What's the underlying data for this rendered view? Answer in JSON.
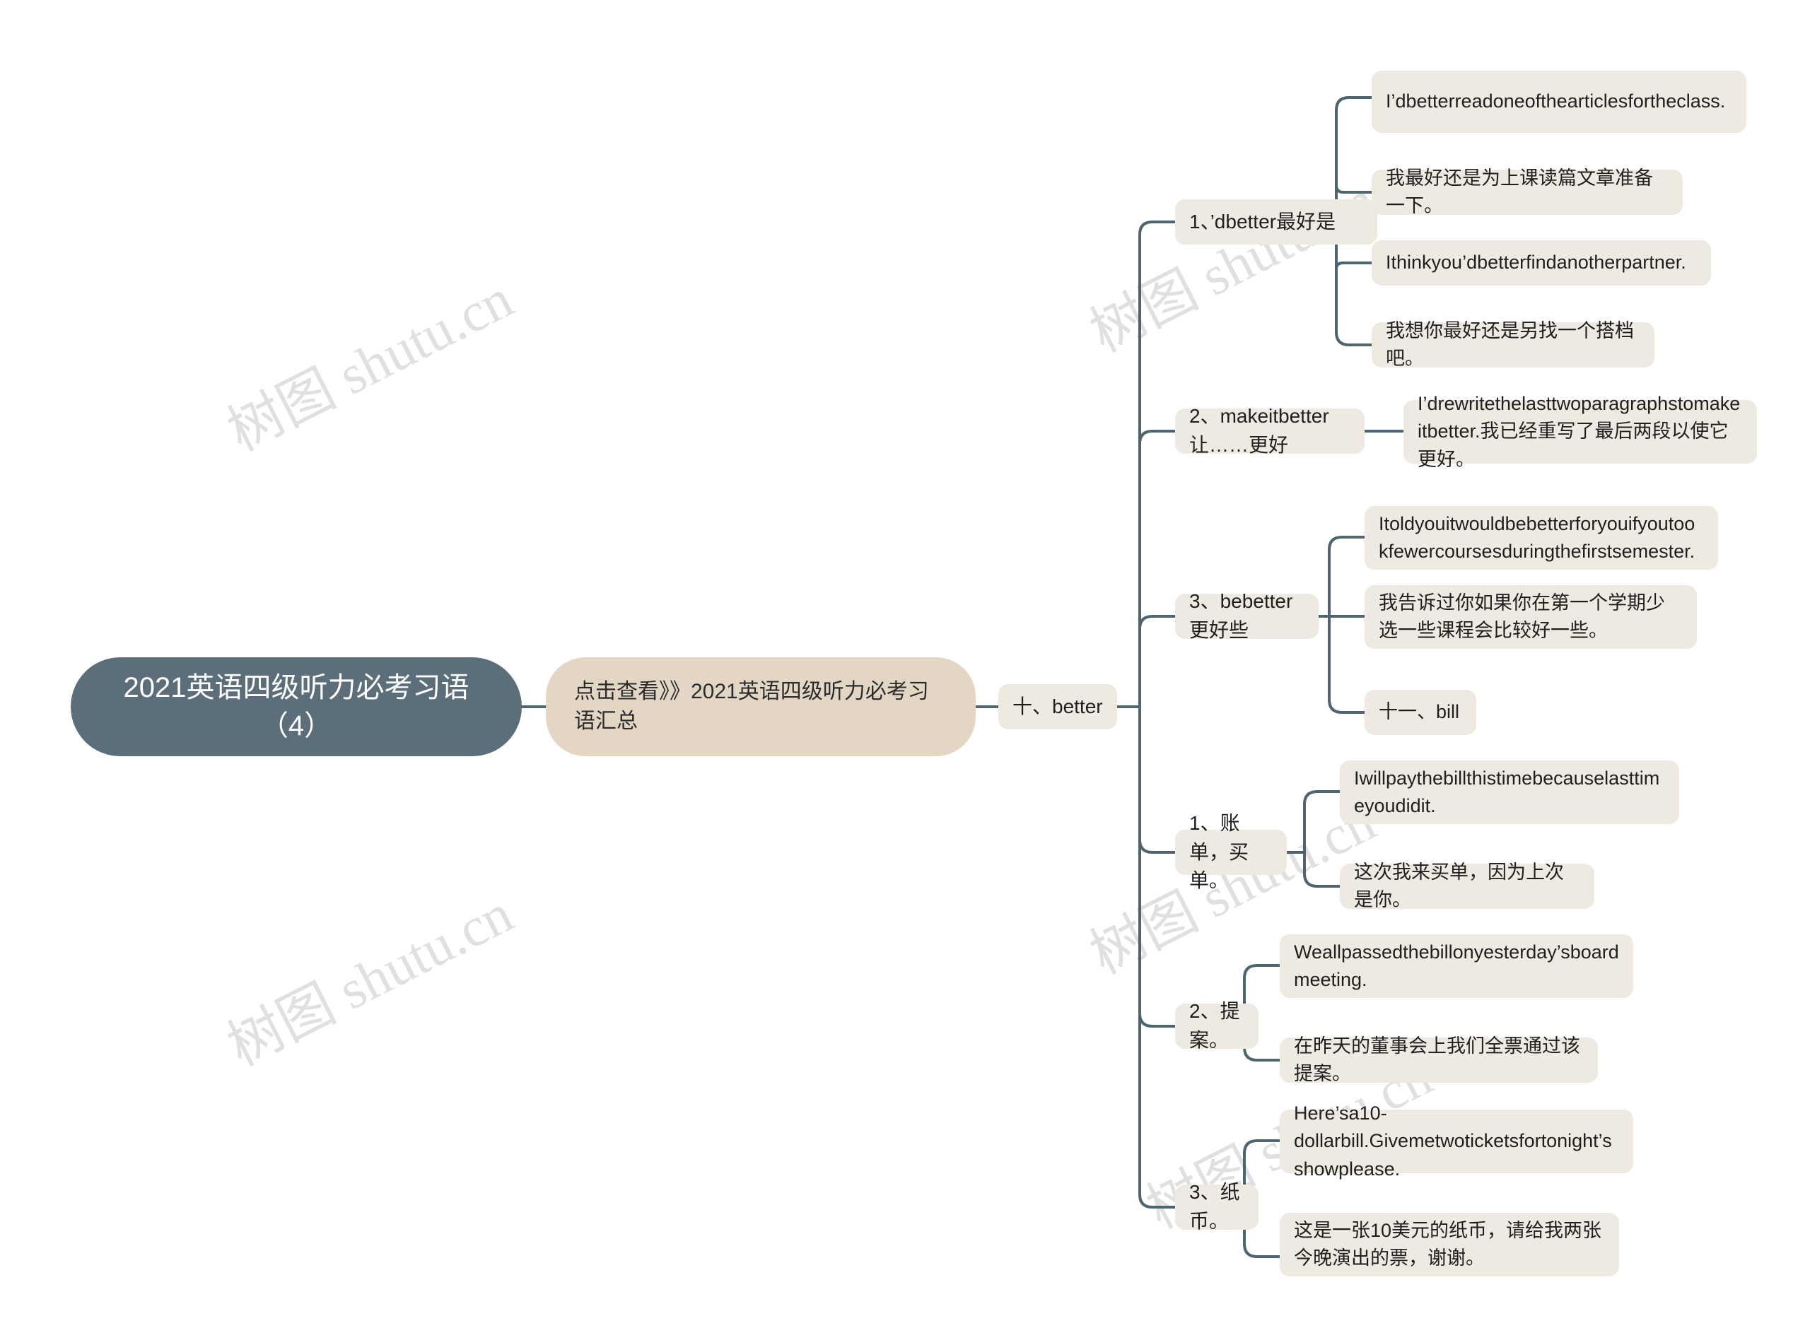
{
  "meta": {
    "background": "#ffffff",
    "root_color": "#5c6e79",
    "branch_color": "#e3d6c4",
    "node_color": "#eeeae1",
    "link_color": "#4e646e",
    "text_color": "#1f1f1f",
    "root_text_color": "#ffffff"
  },
  "watermark": {
    "text_cn": "树图 shutu.cn",
    "color": "#e0e0e0"
  },
  "root": {
    "label": "2021英语四级听力必考习语（4）"
  },
  "branch": {
    "label": "点击查看》》2021英语四级听力必考习语汇总"
  },
  "topic": {
    "label": "十、better"
  },
  "sections": [
    {
      "label": "1、’dbetter最好是",
      "children": [
        {
          "label": "I’dbetterreadoneofthearticlesfortheclass."
        },
        {
          "label": "我最好还是为上课读篇文章准备一下。"
        },
        {
          "label": "Ithinkyou’dbetterfindanotherpartner."
        },
        {
          "label": "我想你最好还是另找一个搭档吧。"
        }
      ]
    },
    {
      "label": "2、makeitbetter让……更好",
      "children": [
        {
          "label": "I’drewritethelasttwoparagraphstomakeitbetter.我已经重写了最后两段以使它更好。"
        }
      ]
    },
    {
      "label": "3、bebetter更好些",
      "children": [
        {
          "label": "Itoldyouitwouldbebetterforyouifyoutookfewercoursesduringthefirstsemester."
        },
        {
          "label": "我告诉过你如果你在第一个学期少选一些课程会比较好一些。"
        },
        {
          "label": "十一、bill"
        }
      ]
    },
    {
      "label": "1、账单，买单。",
      "children": [
        {
          "label": "Iwillpaythebillthistimebecauselasttimeyoudidit."
        },
        {
          "label": "这次我来买单，因为上次是你。"
        }
      ]
    },
    {
      "label": "2、提案。",
      "children": [
        {
          "label": "Weallpassedthebillonyesterday’sboardmeeting."
        },
        {
          "label": "在昨天的董事会上我们全票通过该提案。"
        }
      ]
    },
    {
      "label": "3、纸币。",
      "children": [
        {
          "label": "Here’sa10-dollarbill.Givemetwoticketsfortonight’sshowplease."
        },
        {
          "label": "这是一张10美元的纸币，请给我两张今晚演出的票，谢谢。"
        }
      ]
    }
  ]
}
